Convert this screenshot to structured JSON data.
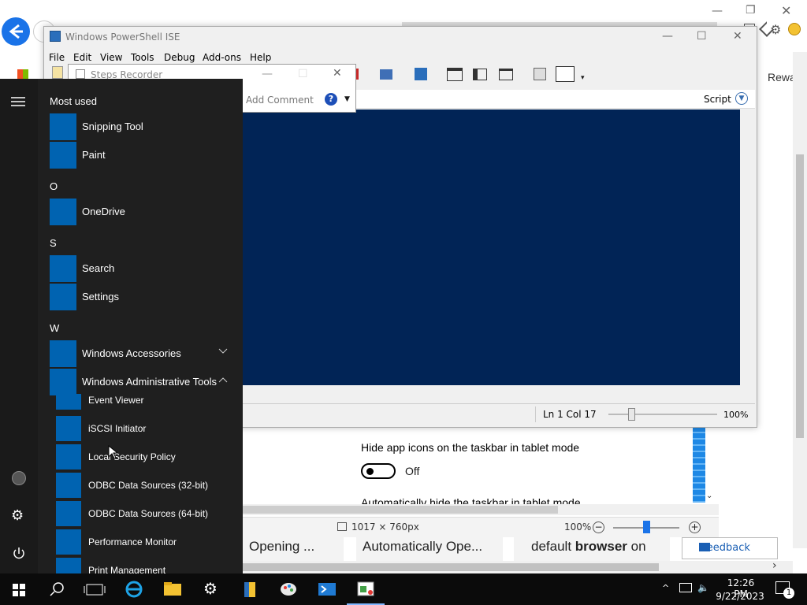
{
  "browser": {
    "reward_text": "Rewa",
    "cards": [
      "Opening ...",
      "Automatically Ope...",
      "default",
      "browser",
      "on"
    ],
    "feedback_label": "Feedback"
  },
  "settings": {
    "hide_icons_label": "Hide app icons on the taskbar in tablet mode",
    "toggle_state": "Off",
    "auto_hide_label": "Automatically hide the taskbar in tablet mode",
    "toggle_on": false
  },
  "steps_recorder": {
    "title": "Steps Recorder",
    "add_comment": "Add Comment",
    "help_glyph": "?",
    "size": "1017 × 760px",
    "zoom": "100%"
  },
  "ise": {
    "title": "Windows PowerShell ISE",
    "menu": [
      "File",
      "Edit",
      "View",
      "Tools",
      "Debug",
      "Add-ons",
      "Help"
    ],
    "script_label": "Script",
    "status": "Ln 1  Col 17",
    "zoom": "100%",
    "console_color": "#012456"
  },
  "start_menu": {
    "section_most_used": "Most used",
    "most_used": [
      "Snipping Tool",
      "Paint"
    ],
    "letter_o": "O",
    "o_items": [
      "OneDrive"
    ],
    "letter_s": "S",
    "s_items": [
      "Search",
      "Settings"
    ],
    "letter_w": "W",
    "w_items": [
      "Windows Accessories",
      "Windows Administrative Tools"
    ],
    "admin_tools": [
      "Event Viewer",
      "iSCSI Initiator",
      "Local Security Policy",
      "ODBC Data Sources (32-bit)",
      "ODBC Data Sources (64-bit)",
      "Performance Monitor",
      "Print Management"
    ],
    "accent": "#0063b1"
  },
  "taskbar": {
    "time": "12:26 PM",
    "date": "9/22/2023",
    "notification_count": "1"
  }
}
